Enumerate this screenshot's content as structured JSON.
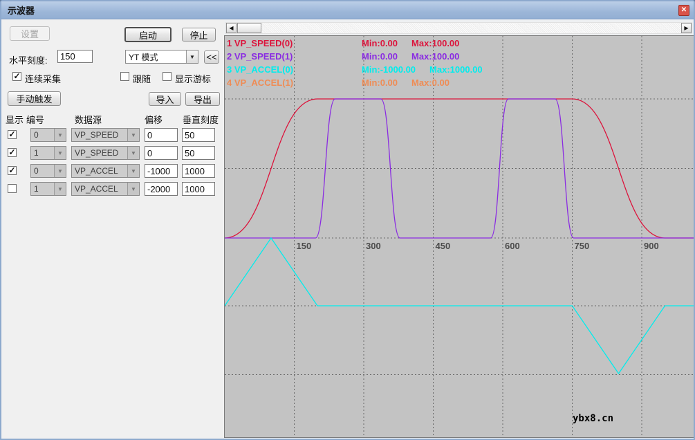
{
  "window": {
    "title": "示波器"
  },
  "icons": {
    "close": "✕",
    "check": "✓",
    "combo_arrow": "▼",
    "scroll_left": "◀",
    "scroll_right": "▶"
  },
  "controls": {
    "settings_label": "设置",
    "start_label": "启动",
    "stop_label": "停止",
    "hscale_label": "水平刻度:",
    "hscale_value": "150",
    "mode_value": "YT 模式",
    "collapse_label": "<<",
    "continuous_label": "连续采集",
    "follow_label": "跟随",
    "cursor_label": "显示游标",
    "manual_trigger_label": "手动触发",
    "import_label": "导入",
    "export_label": "导出"
  },
  "channel_table": {
    "headers": [
      "显示",
      "编号",
      "数据源",
      "偏移",
      "垂直刻度"
    ],
    "rows": [
      {
        "show": true,
        "index": "0",
        "source": "VP_SPEED",
        "offset": "0",
        "scale": "50"
      },
      {
        "show": true,
        "index": "1",
        "source": "VP_SPEED",
        "offset": "0",
        "scale": "50"
      },
      {
        "show": true,
        "index": "0",
        "source": "VP_ACCEL",
        "offset": "-1000",
        "scale": "1000"
      },
      {
        "show": false,
        "index": "1",
        "source": "VP_ACCEL",
        "offset": "-2000",
        "scale": "1000"
      }
    ]
  },
  "legend": [
    {
      "label": "1 VP_SPEED(0)",
      "min": "Min:0.00",
      "max": "Max:100.00",
      "color": "#dc143c"
    },
    {
      "label": "2 VP_SPEED(1)",
      "min": "Min:0.00",
      "max": "Max:100.00",
      "color": "#8a2be2"
    },
    {
      "label": "3 VP_ACCEL(0)",
      "min": "Min:-1000.00",
      "max": "Max:1000.00",
      "color": "#00eded"
    },
    {
      "label": "4 VP_ACCEL(1)",
      "min": "Min:0.00",
      "max": "Max:0.00",
      "color": "#ef8c55"
    }
  ],
  "watermark": "ybx8.cn",
  "chart_data": {
    "type": "line",
    "title": "",
    "xlabel": "",
    "ylabel": "",
    "x_range": [
      0,
      1015
    ],
    "x_ticks": [
      "150",
      "300",
      "450",
      "600",
      "750",
      "900"
    ],
    "grid": "dashed",
    "legend_position": "top-left",
    "series": [
      {
        "name": "VP_SPEED(0)",
        "axis": "speed",
        "color": "#dc143c",
        "smooth": true,
        "points": [
          [
            0,
            0
          ],
          [
            200,
            100
          ],
          [
            750,
            100
          ],
          [
            950,
            0
          ],
          [
            1015,
            0
          ]
        ]
      },
      {
        "name": "VP_SPEED(1)",
        "axis": "speed",
        "color": "#8a2be2",
        "smooth": true,
        "points": [
          [
            0,
            0
          ],
          [
            196,
            0
          ],
          [
            238,
            100
          ],
          [
            337,
            100
          ],
          [
            378,
            0
          ],
          [
            574,
            0
          ],
          [
            612,
            100
          ],
          [
            713,
            100
          ],
          [
            753,
            0
          ],
          [
            1015,
            0
          ]
        ]
      },
      {
        "name": "VP_ACCEL(0)",
        "axis": "accel",
        "color": "#00eded",
        "smooth": false,
        "points": [
          [
            0,
            0
          ],
          [
            100,
            1000
          ],
          [
            200,
            0
          ],
          [
            750,
            0
          ],
          [
            850,
            -1000
          ],
          [
            950,
            0
          ],
          [
            1015,
            0
          ]
        ]
      },
      {
        "name": "VP_ACCEL(1)",
        "axis": "accel",
        "color": "#ef8c55",
        "smooth": false,
        "points": []
      }
    ],
    "axes": {
      "speed": {
        "min": 0,
        "max": 100,
        "units_per_div": 50
      },
      "accel": {
        "min": -1000,
        "max": 1000,
        "units_per_div": 1000
      }
    }
  }
}
